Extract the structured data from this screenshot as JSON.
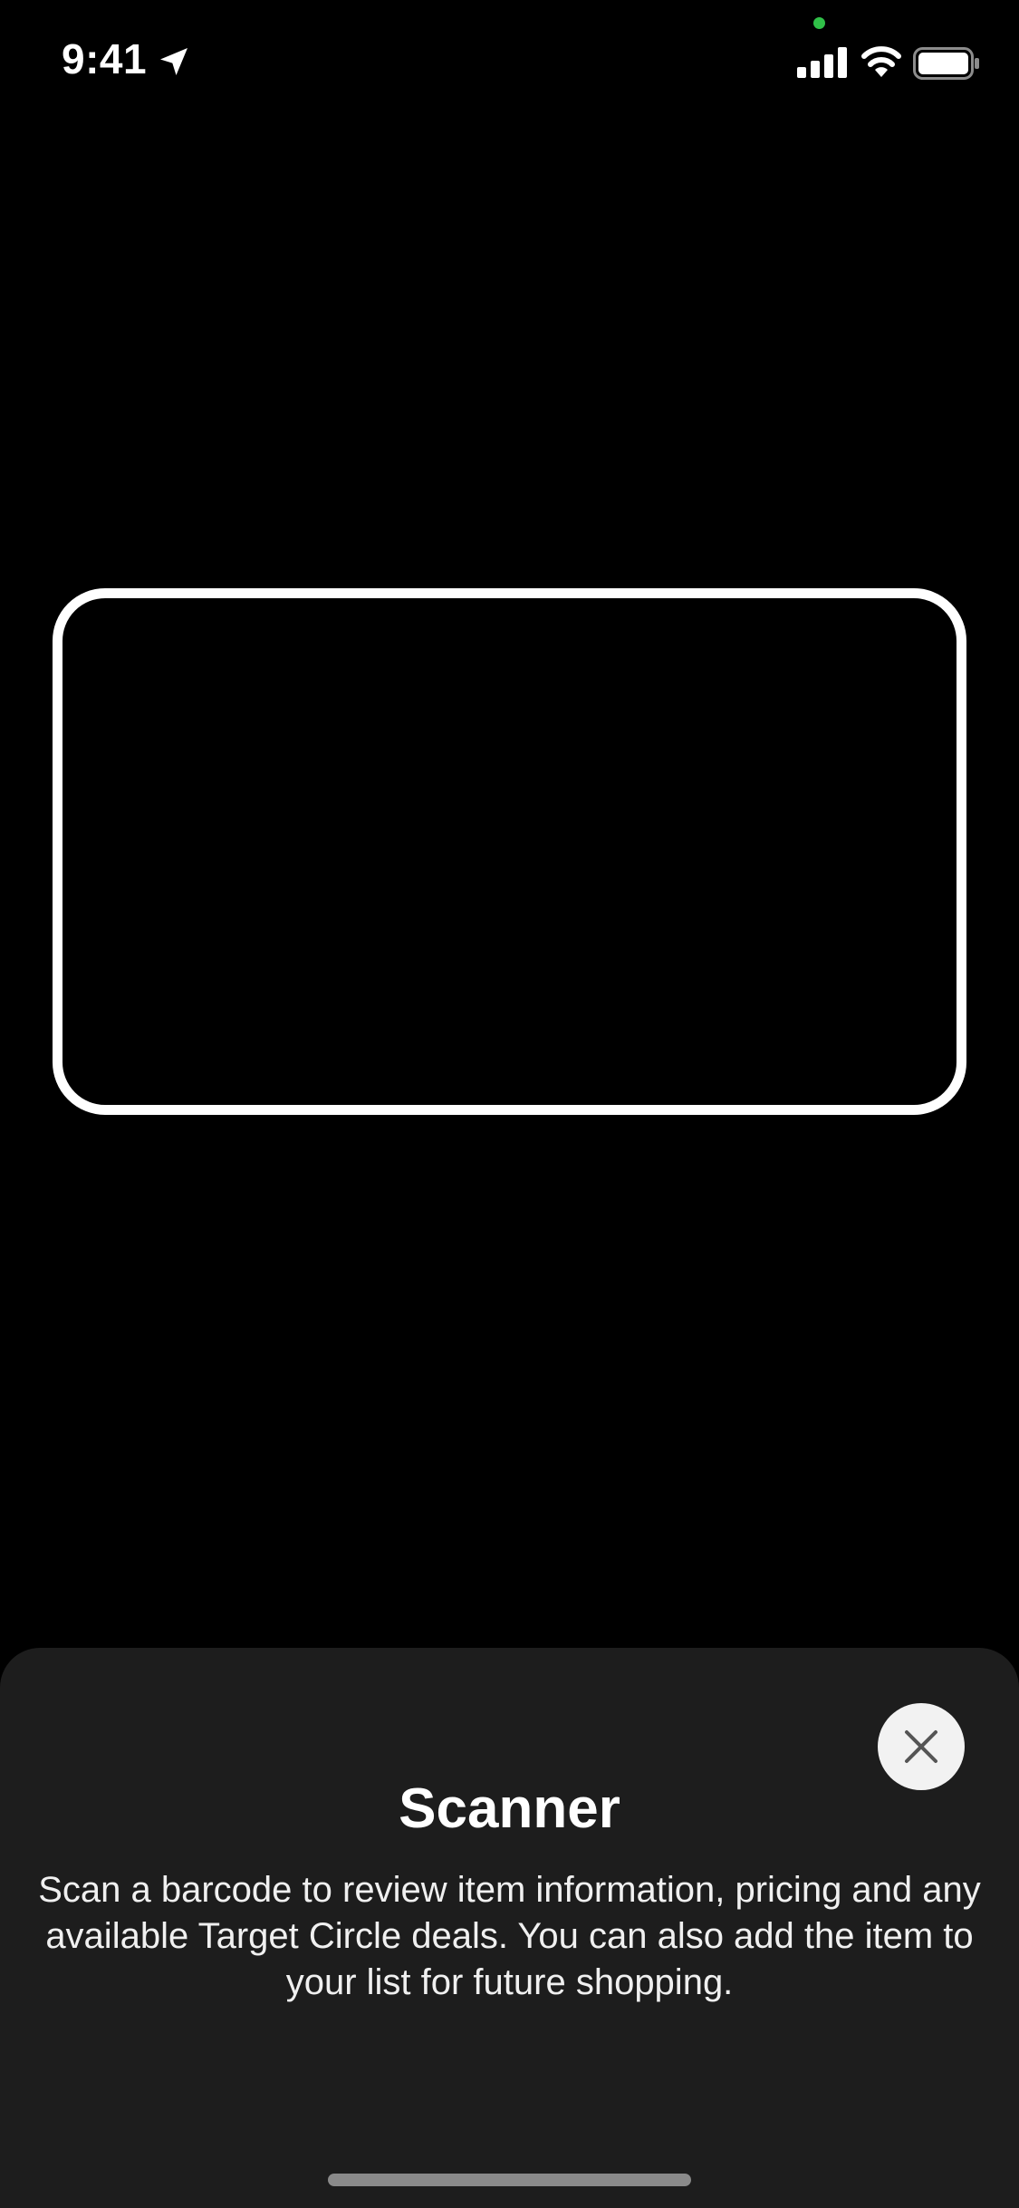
{
  "status_bar": {
    "time": "9:41",
    "location_icon": "location-arrow-icon",
    "signal_icon": "cellular-signal-icon",
    "wifi_icon": "wifi-icon",
    "battery_icon": "battery-icon",
    "camera_indicator_color": "#30c048"
  },
  "scanner": {
    "frame_icon": "scan-frame"
  },
  "sheet": {
    "title": "Scanner",
    "description": "Scan a barcode to review item information, pricing and any available Target Circle deals. You can also add the item to your list for future shopping.",
    "close_icon": "close-icon"
  },
  "colors": {
    "background": "#000000",
    "sheet_background": "#1d1d1d",
    "close_button_background": "#f2f2f2",
    "close_icon_color": "#555555"
  }
}
